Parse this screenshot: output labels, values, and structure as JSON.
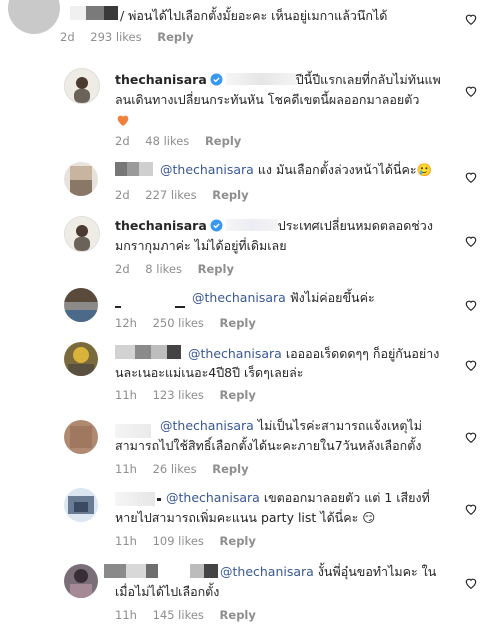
{
  "comments": [
    {
      "text": "/ พ่อนได้ไปเลือกตั้งมั้ยอะคะ เห็นอยู่เมกาแล้วนึกได้",
      "time": "2d",
      "likes": "293 likes",
      "reply": "Reply"
    },
    {
      "user": "thechanisara",
      "text1": "ปีนี้ปีแรกเลยที่กลับไม่ทันแพ",
      "text2": "ลนเดินทางเปลี่ยนกระทันหัน โชคดีเขตนี้ผลออกมาลอยตัว",
      "time": "2d",
      "likes": "48 likes",
      "reply": "Reply"
    },
    {
      "mention": "@thechanisara",
      "text1": "แง มันเลือกตั้งล่วงหน้าได้นี่คะ🥲",
      "time": "2d",
      "likes": "227 likes",
      "reply": "Reply"
    },
    {
      "user": "thechanisara",
      "text1": "ประเทศเปลี่ยนหมดตลอดช่วง",
      "text2": "มกรากุมภาค่ะ ไม่ได้อยู่ที่เดิมเลย",
      "time": "2d",
      "likes": "8 likes",
      "reply": "Reply"
    },
    {
      "mention": "@thechanisara",
      "text1": "ฟังไม่ค่อยขึ้นค่ะ",
      "time": "12h",
      "likes": "250 likes",
      "reply": "Reply"
    },
    {
      "mention": "@thechanisara",
      "text1": "เออออเร็ดดดๆๆ ก็อยู่กันอย่าง",
      "text2": "นละเนอะแม่เนอะ4ปี8ปี เร็ดๆเลยล่ะ",
      "time": "11h",
      "likes": "123 likes",
      "reply": "Reply"
    },
    {
      "mention": "@thechanisara",
      "text1": "ไม่เป็นไรค่ะสามารถแจ้งเหตุไม่",
      "text2": "สามารถไปใช้สิทธิ์เลือกตั้งได้นะคะภายใน7วันหลังเลือกตั้ง",
      "time": "11h",
      "likes": "26 likes",
      "reply": "Reply"
    },
    {
      "mention": "@thechanisara",
      "text1": "เขตออกมาลอยตัว แต่ 1 เสียงที่",
      "text2": "หายไปสามารถเพิ่มคะแนน party list ได้นี่คะ 😏",
      "time": "11h",
      "likes": "109 likes",
      "reply": "Reply"
    },
    {
      "mention": "@thechanisara",
      "text1": "งั้นพี่อุ๋นขอทำไมคะ ใน",
      "text2": "เมื่อไม่ได้ไปเลือกตั้ง",
      "time": "11h",
      "likes": "145 likes",
      "reply": "Reply"
    }
  ]
}
